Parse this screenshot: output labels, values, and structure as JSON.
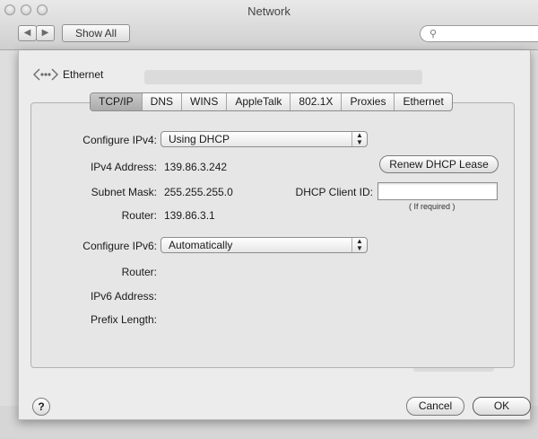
{
  "window": {
    "title": "Network"
  },
  "toolbar": {
    "show_all": "Show All",
    "back_glyph": "◀",
    "forward_glyph": "▶",
    "search_glyph": "⚲"
  },
  "service": {
    "name": "Ethernet"
  },
  "tabs": [
    {
      "label": "TCP/IP",
      "selected": true
    },
    {
      "label": "DNS",
      "selected": false
    },
    {
      "label": "WINS",
      "selected": false
    },
    {
      "label": "AppleTalk",
      "selected": false
    },
    {
      "label": "802.1X",
      "selected": false
    },
    {
      "label": "Proxies",
      "selected": false
    },
    {
      "label": "Ethernet",
      "selected": false
    }
  ],
  "ipv4": {
    "configure_label": "Configure IPv4:",
    "configure_value": "Using DHCP",
    "address_label": "IPv4 Address:",
    "address_value": "139.86.3.242",
    "subnet_label": "Subnet Mask:",
    "subnet_value": "255.255.255.0",
    "router_label": "Router:",
    "router_value": "139.86.3.1",
    "renew_button": "Renew DHCP Lease",
    "client_id_label": "DHCP Client ID:",
    "client_id_value": "",
    "client_id_hint": "( If required )"
  },
  "ipv6": {
    "configure_label": "Configure IPv6:",
    "configure_value": "Automatically",
    "router_label": "Router:",
    "address_label": "IPv6 Address:",
    "prefix_label": "Prefix Length:"
  },
  "footer": {
    "help": "?",
    "cancel": "Cancel",
    "ok": "OK"
  }
}
